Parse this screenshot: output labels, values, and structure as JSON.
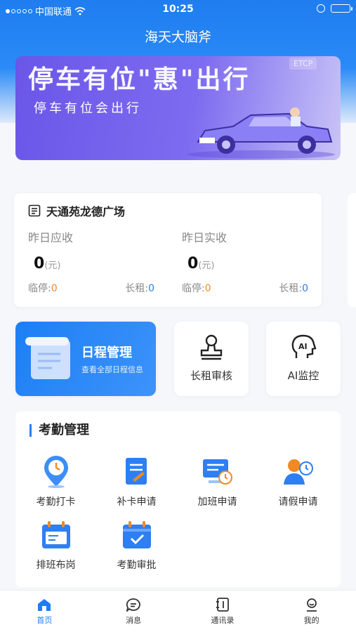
{
  "status": {
    "carrier": "中国联通",
    "time": "10:25"
  },
  "nav": {
    "title": "海天大脑斧"
  },
  "banner": {
    "headline": "停车有位\"惠\"出行",
    "subline": "停车有位会出行",
    "etcp": "ETCP"
  },
  "revenue": {
    "location": "天通苑龙德广场",
    "yesterday_due": {
      "label": "昨日应收",
      "amount": "0",
      "unit": "(元)",
      "temp_label": "临停:",
      "temp_value": "0",
      "long_label": "长租:",
      "long_value": "0"
    },
    "yesterday_actual": {
      "label": "昨日实收",
      "amount": "0",
      "unit": "(元)",
      "temp_label": "临停:",
      "temp_value": "0",
      "long_label": "长租:",
      "long_value": "0"
    }
  },
  "tiles": {
    "schedule": {
      "title": "日程管理",
      "subtitle": "查看全部日程信息"
    },
    "lease_review": "长租审核",
    "ai_monitor": "AI监控"
  },
  "attendance": {
    "title": "考勤管理",
    "items": [
      "考勤打卡",
      "补卡申请",
      "加班申请",
      "请假申请",
      "排班布岗",
      "考勤审批"
    ]
  },
  "tabbar": [
    "首页",
    "消息",
    "通讯录",
    "我的"
  ],
  "colors": {
    "primary": "#1f7df0",
    "accent_orange": "#f08a24"
  }
}
